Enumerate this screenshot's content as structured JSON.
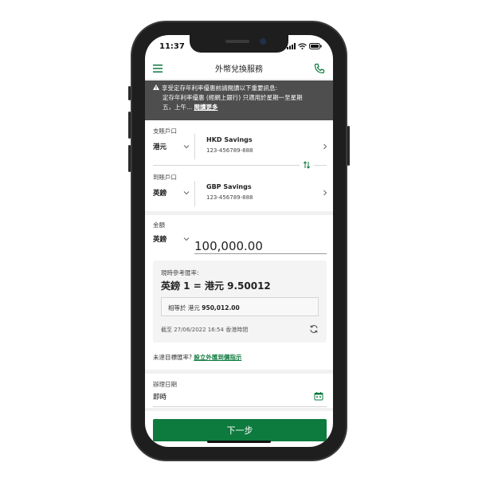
{
  "status": {
    "time": "11:37"
  },
  "header": {
    "title": "外幣兌換服務"
  },
  "notice": {
    "line1": "享受定存年利率優惠前請閱讀以下重要訊息:",
    "line2": "定存年利率優惠 (經網上銀行) 只適用於星期一至星期",
    "line3_prefix": "五，上午...",
    "read_more": "閱讀更多"
  },
  "debit": {
    "label": "支賬戶口",
    "currency": "港元",
    "account_name": "HKD Savings",
    "account_number": "123-456789-888"
  },
  "credit": {
    "label": "到賬戶口",
    "currency": "英鎊",
    "account_name": "GBP Savings",
    "account_number": "123-456789-888"
  },
  "amount": {
    "label": "金額",
    "currency": "英鎊",
    "value": "100,000.00"
  },
  "rate": {
    "label": "現時參考匯率:",
    "value": "英鎊 1 = 港元 9.50012",
    "equivalent_label": "相等於 港元",
    "equivalent_value": "950,012.00",
    "as_of": "截至  27/06/2022 16:54 香港時間"
  },
  "target_rate": {
    "prefix": "未達目標匯率?",
    "link": "設立外匯到價指示"
  },
  "date": {
    "label": "辦理日期",
    "value": "即時"
  },
  "next_button": {
    "label": "下一步"
  },
  "colors": {
    "brand_green": "#0d7a3e",
    "notice_bg": "#4e4e4e"
  }
}
